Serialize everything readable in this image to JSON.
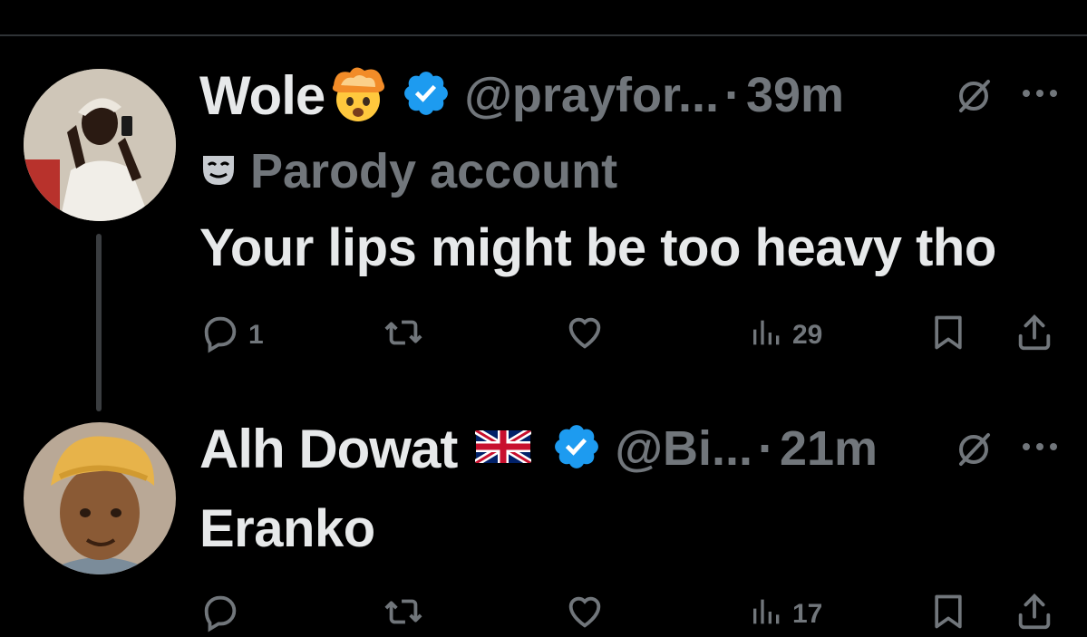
{
  "tweet1": {
    "name": "Wole",
    "name_emoji": "exploding-head-emoji",
    "handle": "@prayfor...",
    "separator": "·",
    "time": "39m",
    "parody_label": "Parody account",
    "text": "Your lips might be too heavy tho",
    "reply_count": "1",
    "views_count": "29"
  },
  "tweet2": {
    "name": "Alh Dowat",
    "flag": "uk-flag-emoji",
    "handle": "@Bi...",
    "separator": "·",
    "time": "21m",
    "text": "Eranko",
    "views_count": "17"
  },
  "colors": {
    "background": "#000000",
    "primary_text": "#e7e9ea",
    "secondary_text": "#71767b",
    "verified_blue": "#1d9bf0",
    "divider": "#2f3336"
  }
}
